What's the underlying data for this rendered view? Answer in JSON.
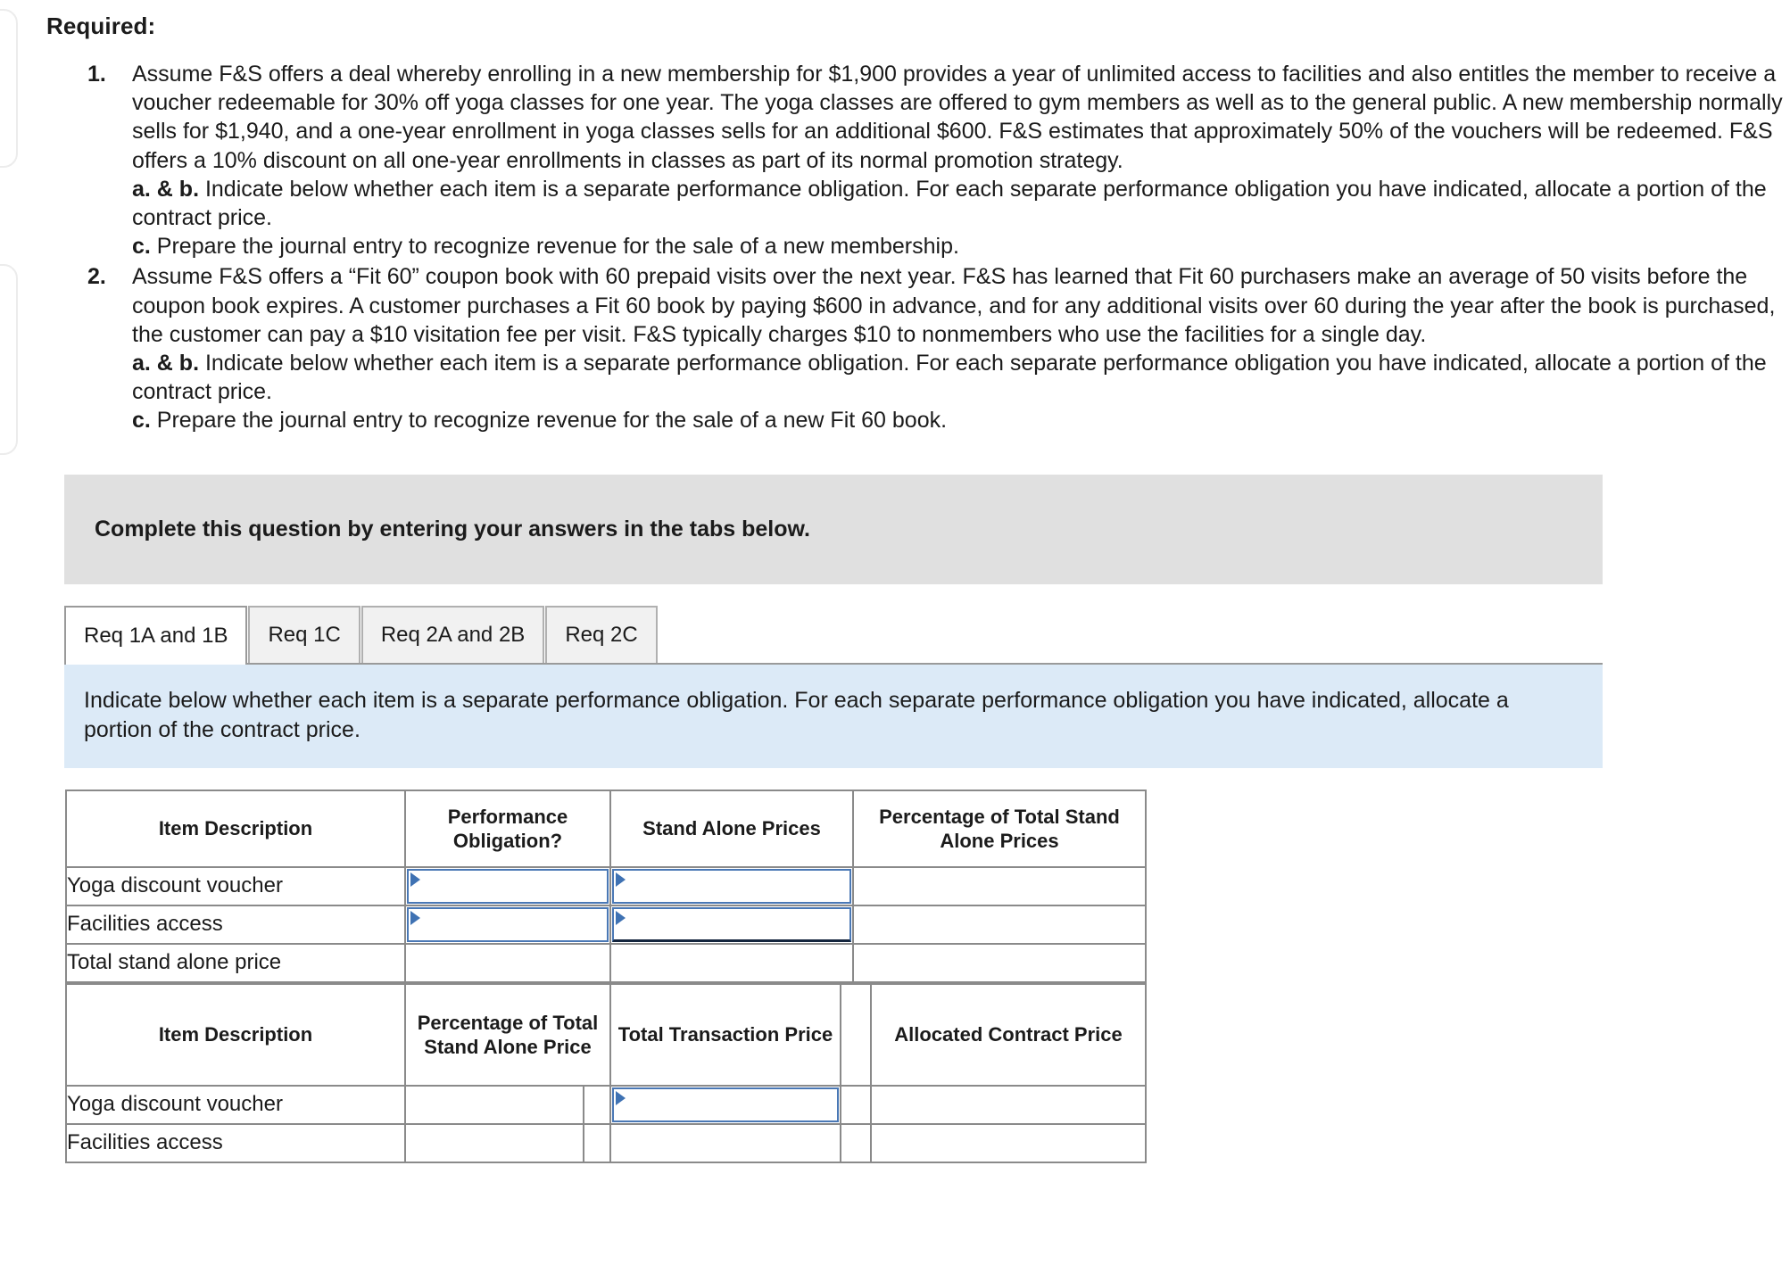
{
  "required": {
    "heading": "Required:",
    "items": [
      {
        "number": "1.",
        "body": "Assume F&S offers a deal whereby enrolling in a new membership for $1,900 provides a year of unlimited access to facilities and also entitles the member to receive a voucher redeemable for 30% off yoga classes for one year. The yoga classes are offered to gym members as well as to the general public. A new membership normally sells for $1,940, and a one-year enrollment in yoga classes sells for an additional $600. F&S estimates that approximately 50% of the vouchers will be redeemed. F&S offers a 10% discount on all one-year enrollments in classes as part of its normal promotion strategy.",
        "sub_ab_label": "a. & b.",
        "sub_ab_text": " Indicate below whether each item is a separate performance obligation. For each separate performance obligation you have indicated, allocate a portion of the contract price.",
        "sub_c_label": "c.",
        "sub_c_text": " Prepare the journal entry to recognize revenue for the sale of a new membership."
      },
      {
        "number": "2.",
        "body": "Assume F&S offers a “Fit 60” coupon book with 60 prepaid visits over the next year. F&S has learned that Fit 60 purchasers make an average of 50 visits before the coupon book expires. A customer purchases a Fit 60 book by paying $600 in advance, and for any additional visits over 60 during the year after the book is purchased, the customer can pay a $10 visitation fee per visit. F&S typically charges $10 to nonmembers who use the facilities for a single day.",
        "sub_ab_label": "a. & b.",
        "sub_ab_text": " Indicate below whether each item is a separate performance obligation. For each separate performance obligation you have indicated, allocate a portion of the contract price.",
        "sub_c_label": "c.",
        "sub_c_text": " Prepare the journal entry to recognize revenue for the sale of a new Fit 60 book."
      }
    ]
  },
  "banner": {
    "text": "Complete this question by entering your answers in the tabs below."
  },
  "tabs": [
    {
      "label": "Req 1A and 1B",
      "active": true
    },
    {
      "label": "Req 1C",
      "active": false
    },
    {
      "label": "Req 2A and 2B",
      "active": false
    },
    {
      "label": "Req 2C",
      "active": false
    }
  ],
  "instruction": {
    "text": "Indicate below whether each item is a separate performance obligation. For each separate performance obligation you have indicated, allocate a portion of the contract price."
  },
  "table_one": {
    "headers": [
      "Item Description",
      "Performance Obligation?",
      "Stand Alone Prices",
      "Percentage of Total Stand Alone Prices"
    ],
    "rows": [
      {
        "label": "Yoga discount voucher",
        "performance_obligation": "",
        "stand_alone_price": "",
        "percentage": ""
      },
      {
        "label": "Facilities access",
        "performance_obligation": "",
        "stand_alone_price": "",
        "percentage": ""
      },
      {
        "label": "Total stand alone price",
        "performance_obligation": "",
        "stand_alone_price": "",
        "percentage": ""
      }
    ]
  },
  "table_two": {
    "headers": [
      "Item Description",
      "Percentage of Total Stand Alone Price",
      "Total Transaction Price",
      "",
      "Allocated Contract Price"
    ],
    "rows": [
      {
        "label": "Yoga discount voucher",
        "percentage": "",
        "total_transaction_price": "",
        "mid": "",
        "allocated_contract_price": ""
      },
      {
        "label": "Facilities access",
        "percentage": "",
        "total_transaction_price": "",
        "mid": "",
        "allocated_contract_price": ""
      }
    ]
  },
  "colors": {
    "header_blue": "#83abe0",
    "instruction_blue": "#dceaf7",
    "banner_gray": "#e0e0e0",
    "input_border_blue": "#4a78b5"
  }
}
